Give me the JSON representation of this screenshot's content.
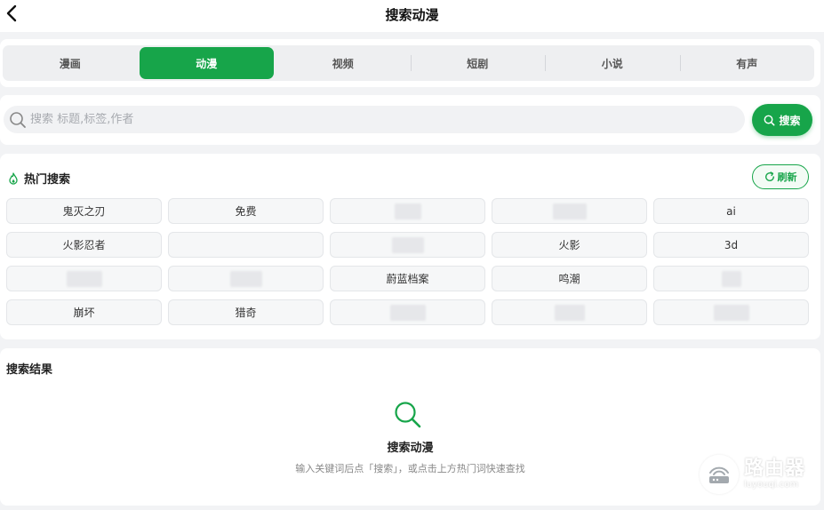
{
  "header": {
    "title": "搜索动漫"
  },
  "tabs": [
    {
      "label": "漫画",
      "active": false
    },
    {
      "label": "动漫",
      "active": true
    },
    {
      "label": "视频",
      "active": false
    },
    {
      "label": "短剧",
      "active": false
    },
    {
      "label": "小说",
      "active": false
    },
    {
      "label": "有声",
      "active": false
    }
  ],
  "search": {
    "placeholder": "搜索 标题,标签,作者",
    "value": "",
    "button_label": "搜索"
  },
  "hot": {
    "title": "热门搜索",
    "refresh_label": "刷新",
    "tags": [
      "鬼灭之刃",
      "免费",
      "",
      "",
      "ai",
      "火影忍者",
      "",
      "",
      "火影",
      "3d",
      "",
      "",
      "蔚蓝档案",
      "鸣潮",
      "",
      "崩坏",
      "猎奇",
      "",
      "",
      ""
    ]
  },
  "results": {
    "title": "搜索结果",
    "empty_title": "搜索动漫",
    "empty_desc": "输入关键词后点「搜索」，或点击上方热门词快速查找"
  },
  "watermark": {
    "name": "路由器",
    "url": "luyouqi.com"
  },
  "colors": {
    "accent": "#17a54a",
    "background": "#f2f3f5",
    "card": "#ffffff"
  }
}
